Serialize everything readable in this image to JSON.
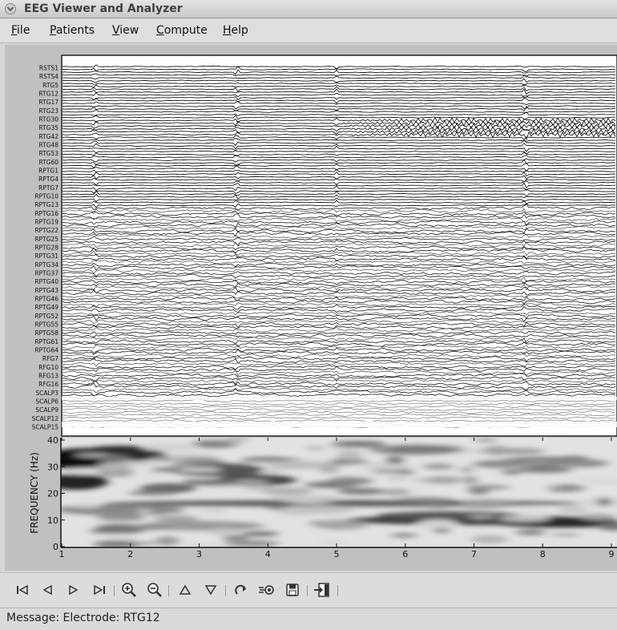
{
  "window": {
    "title": "EEG Viewer and Analyzer"
  },
  "menu": {
    "items": [
      "File",
      "Patients",
      "View",
      "Compute",
      "Help"
    ]
  },
  "plot": {
    "channels": [
      "RSTS1",
      "RSTS4",
      "RTG5",
      "RTG12",
      "RTG17",
      "RTG23",
      "RTG30",
      "RTG35",
      "RTG42",
      "RTG48",
      "RTG53",
      "RTG60",
      "RPTG1",
      "RPTG4",
      "RPTG7",
      "RPTG10",
      "RPTG13",
      "RPTG16",
      "RPTG19",
      "RPTG22",
      "RPTG25",
      "RPTG28",
      "RPTG31",
      "RPTG34",
      "RPTG37",
      "RPTG40",
      "RPTG43",
      "RPTG46",
      "RPTG49",
      "RPTG52",
      "RPTG55",
      "RPTG58",
      "RPTG61",
      "RPTG64",
      "RFG7",
      "RFG10",
      "RFG13",
      "RFG16",
      "SCALP3",
      "SCALP6",
      "SCALP9",
      "SCALP12",
      "SCALP15"
    ],
    "spectrogram": {
      "ylabel": "FREQUENCY (Hz)",
      "yticks": [
        "40",
        "30",
        "20",
        "10",
        "0"
      ],
      "xticks": [
        "1",
        "2",
        "3",
        "4",
        "5",
        "6",
        "7",
        "8",
        "9"
      ]
    }
  },
  "toolbar": {
    "buttons": [
      {
        "name": "first-page-button",
        "icon": "skip-start-icon"
      },
      {
        "name": "previous-button",
        "icon": "play-left-icon"
      },
      {
        "name": "next-button",
        "icon": "play-right-icon"
      },
      {
        "name": "last-page-button",
        "icon": "skip-end-icon"
      },
      {
        "name": "zoom-in-button",
        "icon": "zoom-in-icon"
      },
      {
        "name": "zoom-out-button",
        "icon": "zoom-out-icon"
      },
      {
        "name": "scroll-up-button",
        "icon": "triangle-up-icon"
      },
      {
        "name": "scroll-down-button",
        "icon": "triangle-down-icon"
      },
      {
        "name": "refresh-button",
        "icon": "redo-icon"
      },
      {
        "name": "analyze-button",
        "icon": "analyze-icon"
      },
      {
        "name": "save-button",
        "icon": "floppy-icon"
      },
      {
        "name": "exit-button",
        "icon": "exit-icon"
      }
    ]
  },
  "status": {
    "message": "Message: Electrode: RTG12"
  }
}
